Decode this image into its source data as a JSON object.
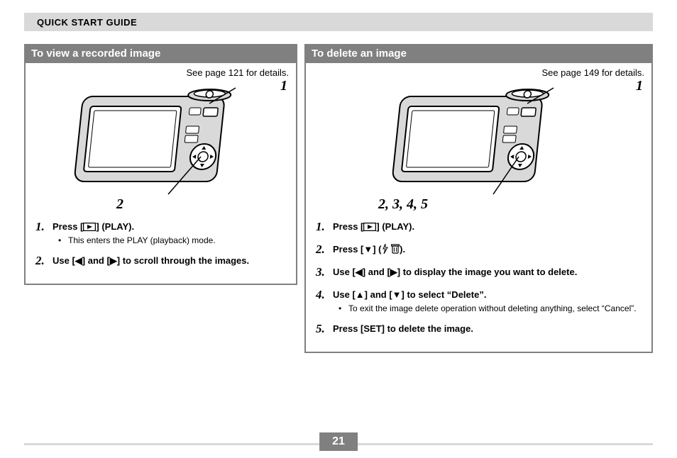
{
  "header": {
    "title": "QUICK START GUIDE"
  },
  "left": {
    "title": "To view a recorded image",
    "see_page": "See page 121 for details.",
    "callouts": {
      "c1": "1",
      "c2": "2"
    },
    "steps": [
      {
        "num": "1.",
        "text_before": "Press [",
        "text_after": "] (PLAY).",
        "icon": "play-rect",
        "bullets": [
          "This enters the PLAY (playback) mode."
        ]
      },
      {
        "num": "2.",
        "text": "Use [◀] and [▶] to scroll through the images."
      }
    ]
  },
  "right": {
    "title": "To delete an image",
    "see_page": "See page 149 for details.",
    "callouts": {
      "c1": "1",
      "c2": "2, 3, 4, 5"
    },
    "steps": [
      {
        "num": "1.",
        "text_before": "Press [",
        "text_after": "] (PLAY).",
        "icon": "play-rect"
      },
      {
        "num": "2.",
        "text_before": "Press [▼] (",
        "text_after": ").",
        "icon": "flash-trash"
      },
      {
        "num": "3.",
        "text": "Use [◀] and [▶] to display the image you want to delete."
      },
      {
        "num": "4.",
        "text": "Use [▲] and [▼] to select “Delete”.",
        "bullets": [
          "To exit the image delete operation without deleting anything, select “Cancel”."
        ]
      },
      {
        "num": "5.",
        "text": "Press [SET] to delete the image."
      }
    ]
  },
  "page_number": "21"
}
